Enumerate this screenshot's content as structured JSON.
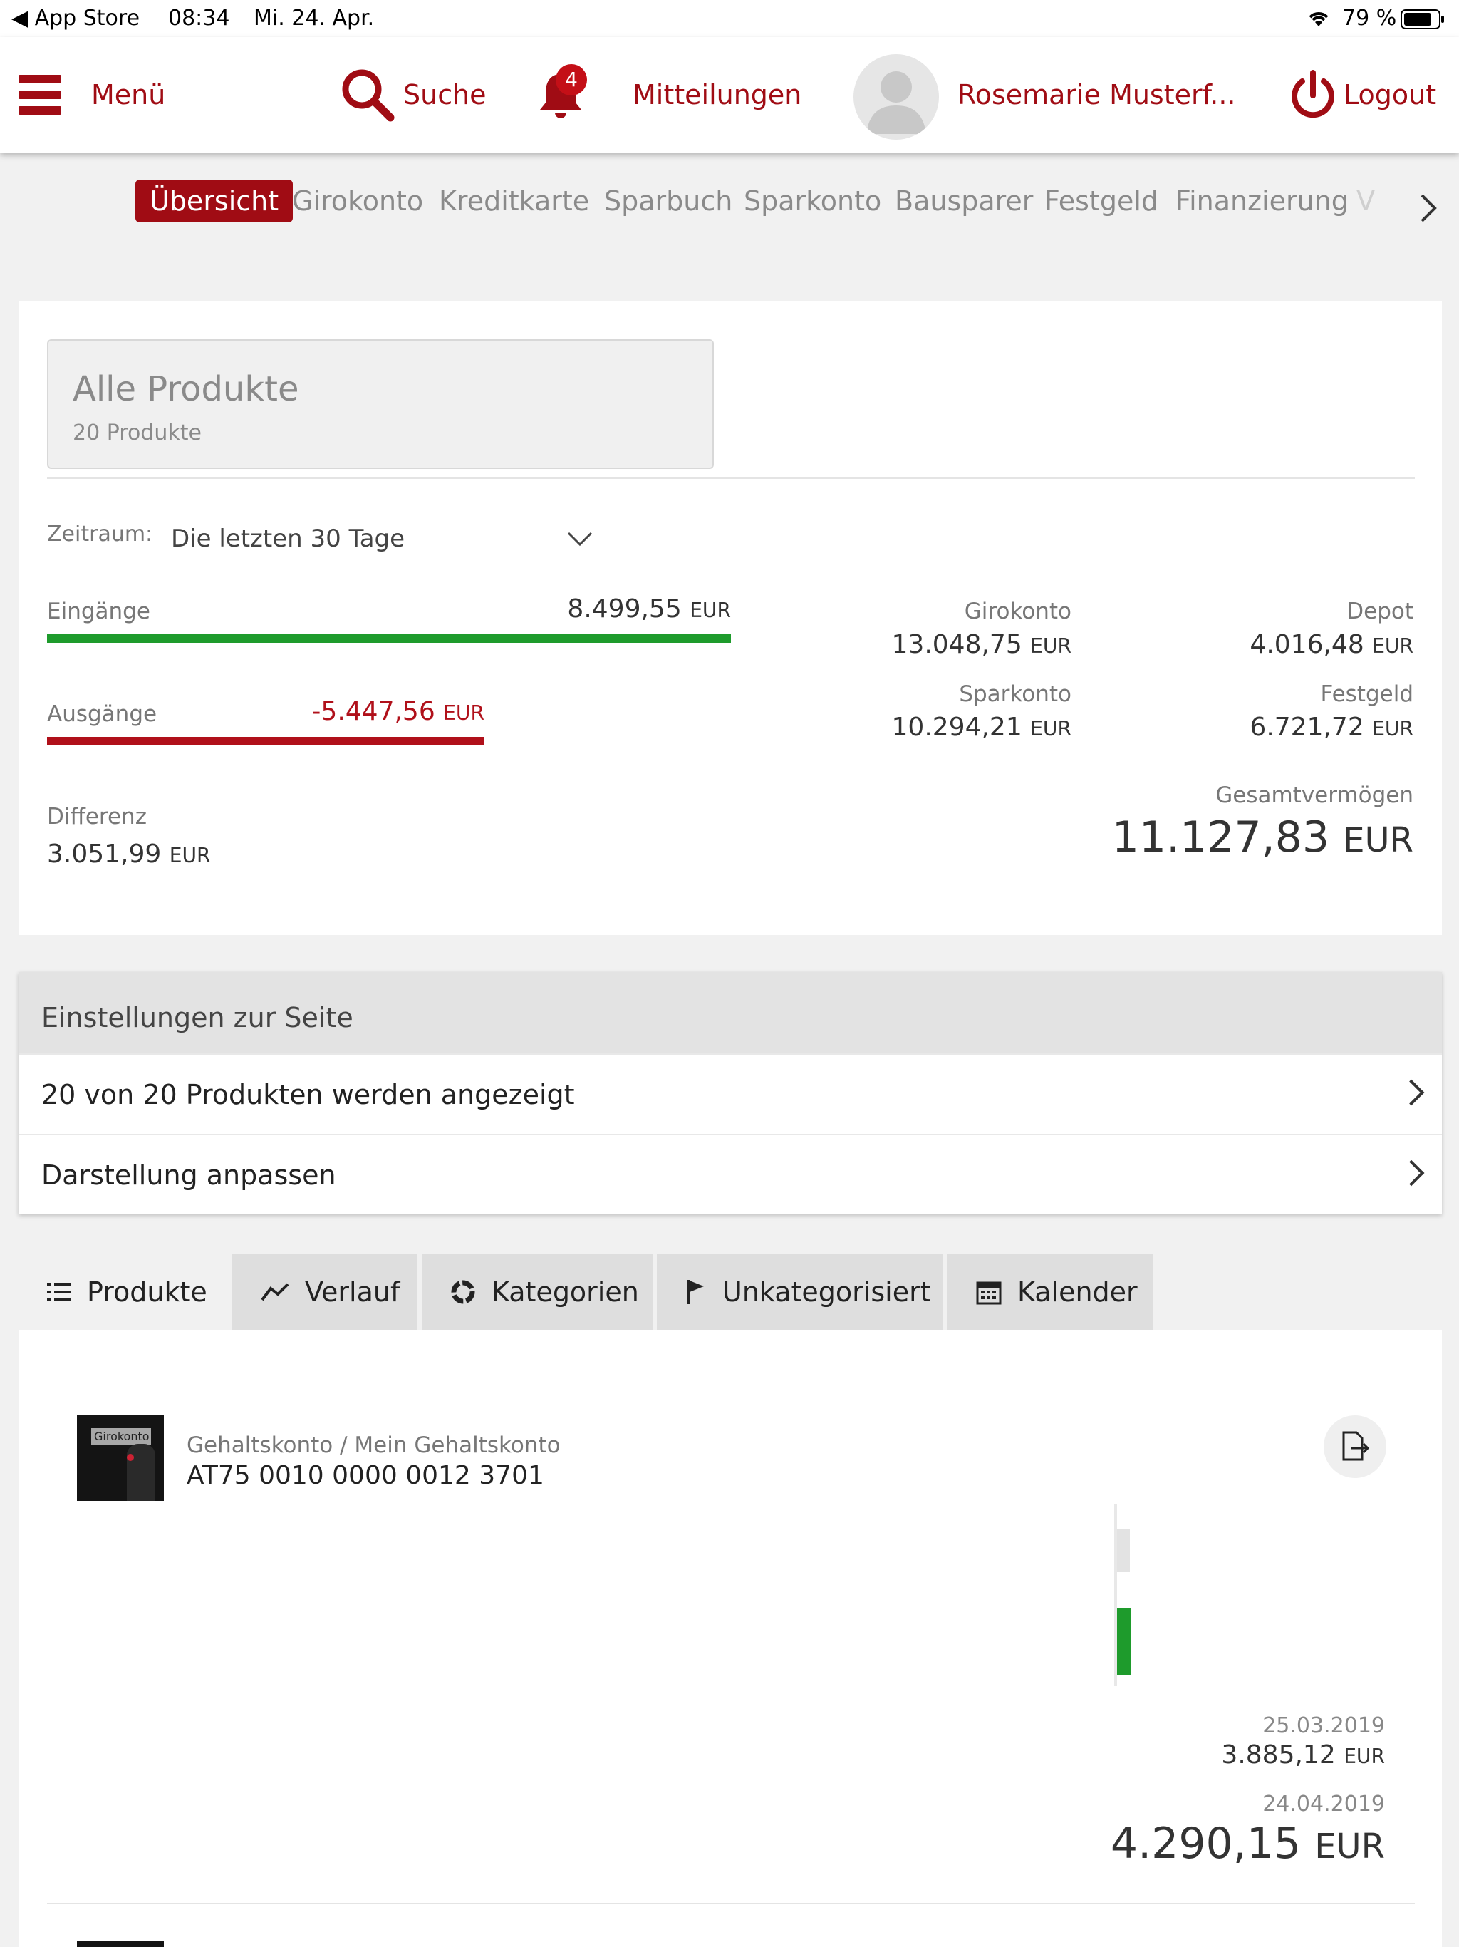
{
  "status_bar": {
    "back_app": "◀ App Store",
    "time": "08:34",
    "date": "Mi. 24. Apr.",
    "battery": "79 %"
  },
  "topnav": {
    "menu": "Menü",
    "search": "Suche",
    "notifications_count": "4",
    "notifications": "Mitteilungen",
    "user": "Rosemarie Musterf...",
    "logout": "Logout"
  },
  "product_tabs": [
    "Übersicht",
    "Girokonto",
    "Kreditkarte",
    "Sparbuch",
    "Sparkonto",
    "Bausparer",
    "Festgeld",
    "Finanzierung",
    "V"
  ],
  "overview": {
    "selector_title": "Alle Produkte",
    "selector_sub": "20 Produkte",
    "period_label": "Zeitraum:",
    "period_value": "Die letzten 30 Tage",
    "income_label": "Eingänge",
    "income_value": "8.499,55",
    "expense_label": "Ausgänge",
    "expense_value": "-5.447,56",
    "currency": "EUR",
    "diff_label": "Differenz",
    "diff_value": "3.051,99",
    "income_bar_fraction": 1.0,
    "expense_bar_fraction": 0.64,
    "accounts": [
      {
        "name": "Girokonto",
        "value": "13.048,75"
      },
      {
        "name": "Depot",
        "value": "4.016,48"
      },
      {
        "name": "Sparkonto",
        "value": "10.294,21"
      },
      {
        "name": "Festgeld",
        "value": "6.721,72"
      }
    ],
    "total_label": "Gesamtvermögen",
    "total_value": "11.127,83"
  },
  "settings": {
    "title": "Einstellungen zur Seite",
    "row1": "20 von 20 Produkten werden angezeigt",
    "row2": "Darstellung anpassen"
  },
  "view_tabs": [
    "Produkte",
    "Verlauf",
    "Kategorien",
    "Unkategorisiert",
    "Kalender"
  ],
  "product": {
    "thumb_label": "Girokonto",
    "name": "Gehaltskonto / Mein Gehaltskonto",
    "iban": "AT75 0010 0000 0012 3701",
    "date1": "25.03.2019",
    "value1": "3.885,12",
    "date2": "24.04.2019",
    "value2": "4.290,15",
    "currency": "EUR"
  },
  "colors": {
    "brand_red": "#a00c14",
    "income_green": "#1e9b2c",
    "expense_red": "#b0101a"
  }
}
